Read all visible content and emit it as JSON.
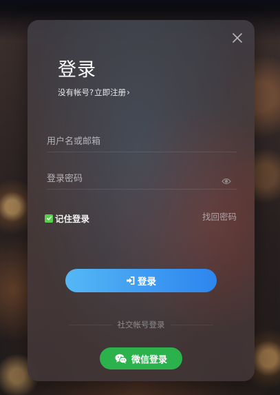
{
  "dialog": {
    "title": "登录",
    "register_prompt": "没有帐号?",
    "register_link": "立即注册"
  },
  "form": {
    "username_placeholder": "用户名或邮箱",
    "password_placeholder": "登录密码",
    "remember_label": "记住登录",
    "remember_checked": true,
    "forgot_label": "找回密码",
    "login_label": "登录"
  },
  "social": {
    "divider_label": "社交帐号登录",
    "wechat_label": "微信登录"
  },
  "colors": {
    "login_button": "#3e9af2",
    "wechat_button": "#2bb24c",
    "checkbox": "#56d04a"
  },
  "icons": [
    "close-icon",
    "chevron-right-icon",
    "eye-icon",
    "check-icon",
    "login-icon",
    "wechat-icon"
  ]
}
